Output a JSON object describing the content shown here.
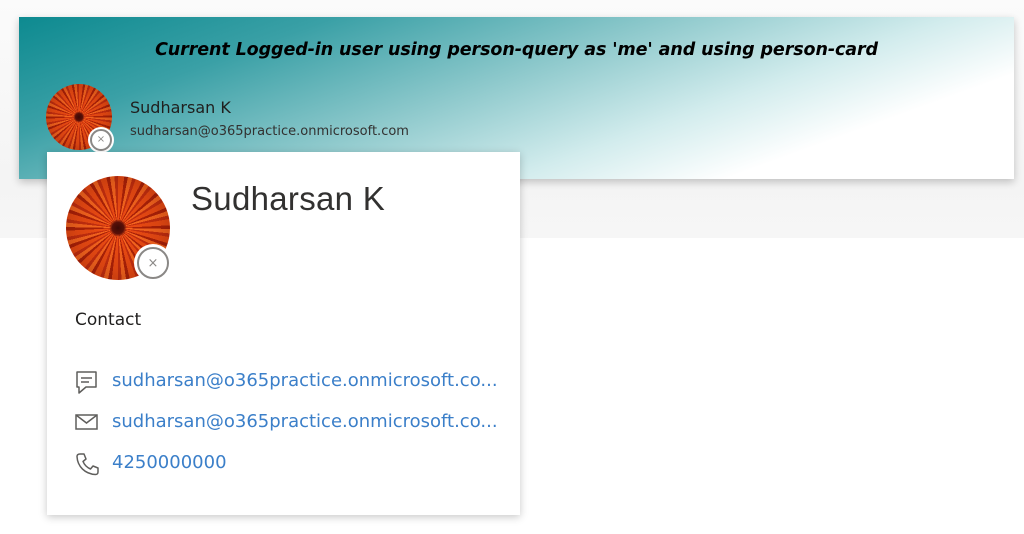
{
  "banner": {
    "title": "Current Logged-in user using person-query as 'me' and using person-card"
  },
  "person": {
    "name": "Sudharsan K",
    "email": "sudharsan@o365practice.onmicrosoft.com",
    "presence_glyph": "×",
    "presence_icon": "presence-offline-icon"
  },
  "card": {
    "name": "Sudharsan K",
    "contact_heading": "Contact",
    "contacts": [
      {
        "icon": "chat-icon",
        "text": "sudharsan@o365practice.onmicrosoft.co..."
      },
      {
        "icon": "mail-icon",
        "text": "sudharsan@o365practice.onmicrosoft.co..."
      },
      {
        "icon": "phone-icon",
        "text": "4250000000"
      }
    ]
  },
  "colors": {
    "banner_teal": "#0d8a90",
    "link_blue": "#3b7fc9",
    "presence_gray": "#8a8886"
  }
}
